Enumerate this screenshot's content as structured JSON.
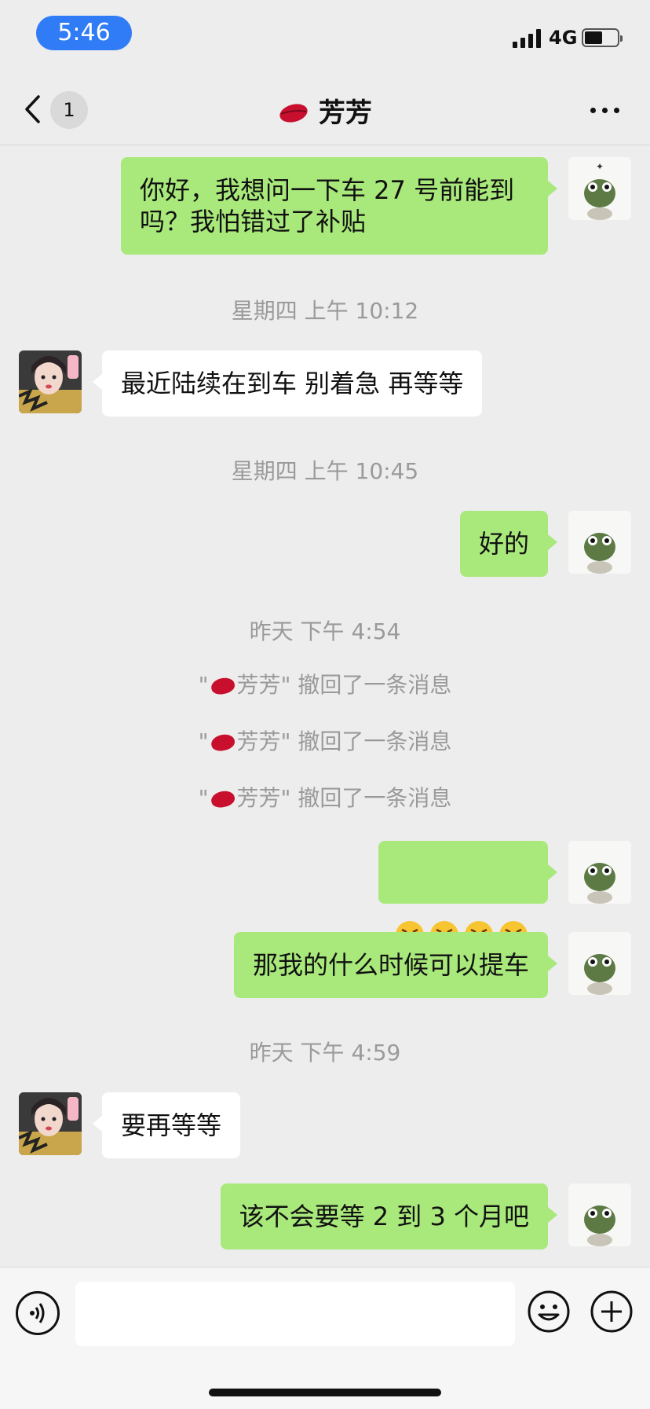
{
  "status_bar": {
    "time": "5:46",
    "network": "4G",
    "battery_level": 0.55
  },
  "header": {
    "unread_count": "1",
    "title": "芳芳",
    "title_icon": "kiss-mark-icon"
  },
  "messages": [
    {
      "side": "out",
      "text": "你好，我想问一下车 27 号前能到吗？我怕错过了补贴"
    },
    {
      "type": "timestamp",
      "text": "星期四 上午 10:12"
    },
    {
      "side": "in",
      "text": "最近陆续在到车 别着急 再等等"
    },
    {
      "type": "timestamp",
      "text": "星期四 上午 10:45"
    },
    {
      "side": "out",
      "text": "好的"
    },
    {
      "type": "timestamp",
      "text": "昨天 下午 4:54"
    },
    {
      "type": "recall",
      "name": "芳芳",
      "text": "撤回了一条消息"
    },
    {
      "type": "recall",
      "name": "芳芳",
      "text": "撤回了一条消息"
    },
    {
      "type": "recall",
      "name": "芳芳",
      "text": "撤回了一条消息"
    },
    {
      "side": "out",
      "emoji": [
        "rolling-on-floor-laughing",
        "rolling-on-floor-laughing",
        "rolling-on-floor-laughing",
        "rolling-on-floor-laughing"
      ]
    },
    {
      "side": "out",
      "text": "那我的什么时候可以提车"
    },
    {
      "type": "timestamp",
      "text": "昨天 下午 4:59"
    },
    {
      "side": "in",
      "text": "要再等等"
    },
    {
      "side": "out",
      "text": "该不会要等 2 到 3 个月吧"
    }
  ],
  "input": {
    "placeholder": ""
  },
  "colors": {
    "out_bubble": "#a9e97b",
    "in_bubble": "#ffffff",
    "background": "#ededed",
    "time_pill": "#2f7cf6"
  }
}
